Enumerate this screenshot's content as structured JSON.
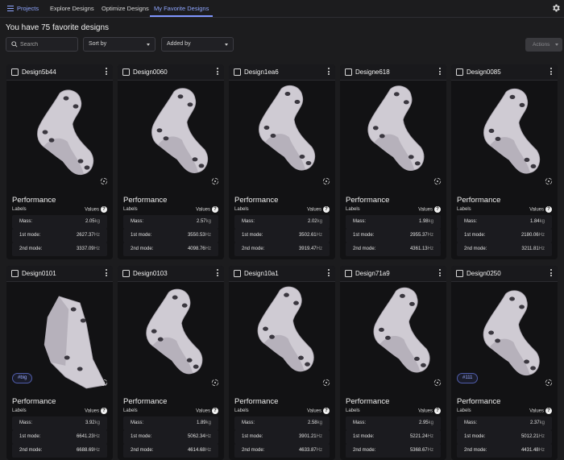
{
  "nav": {
    "projects": "Projects",
    "tabs": [
      {
        "label": "Explore Designs"
      },
      {
        "label": "Optimize Designs"
      },
      {
        "label": "My Favorite Designs"
      }
    ]
  },
  "header": {
    "title": "You have 75 favorite designs",
    "search_placeholder": "Search",
    "sort_by": "Sort by",
    "added_by": "Added by",
    "actions": "Actions"
  },
  "card_labels": {
    "performance": "Performance",
    "labels": "Labels",
    "values": "Values",
    "mass": "Mass:",
    "mode1": "1st mode:",
    "mode2": "2nd mode:",
    "kg": "kg",
    "hz": "Hz"
  },
  "colors": {
    "accent": "#7f95ff",
    "card_bg": "#121214",
    "page_bg": "#1c1c1e"
  },
  "cards": [
    {
      "name": "Design5b44",
      "mass": "2.05",
      "mode1": "2627.37",
      "mode2": "3337.09",
      "tag": ""
    },
    {
      "name": "Design0060",
      "mass": "2.57",
      "mode1": "3550.53",
      "mode2": "4098.76",
      "tag": ""
    },
    {
      "name": "Design1ea6",
      "mass": "2.02",
      "mode1": "3502.61",
      "mode2": "3919.47",
      "tag": ""
    },
    {
      "name": "Designe618",
      "mass": "1.98",
      "mode1": "2955.37",
      "mode2": "4361.13",
      "tag": ""
    },
    {
      "name": "Design0085",
      "mass": "1.84",
      "mode1": "2180.06",
      "mode2": "3211.81",
      "tag": ""
    },
    {
      "name": "Design0101",
      "mass": "3.92",
      "mode1": "6641.23",
      "mode2": "6688.69",
      "tag": "#big"
    },
    {
      "name": "Design0103",
      "mass": "1.89",
      "mode1": "5062.34",
      "mode2": "4614.68",
      "tag": ""
    },
    {
      "name": "Design10a1",
      "mass": "2.58",
      "mode1": "3901.21",
      "mode2": "4633.87",
      "tag": ""
    },
    {
      "name": "Design71a9",
      "mass": "2.95",
      "mode1": "5221.24",
      "mode2": "5368.67",
      "tag": ""
    },
    {
      "name": "Design0250",
      "mass": "2.37",
      "mode1": "5012.21",
      "mode2": "4431.48",
      "tag": "#111"
    }
  ]
}
